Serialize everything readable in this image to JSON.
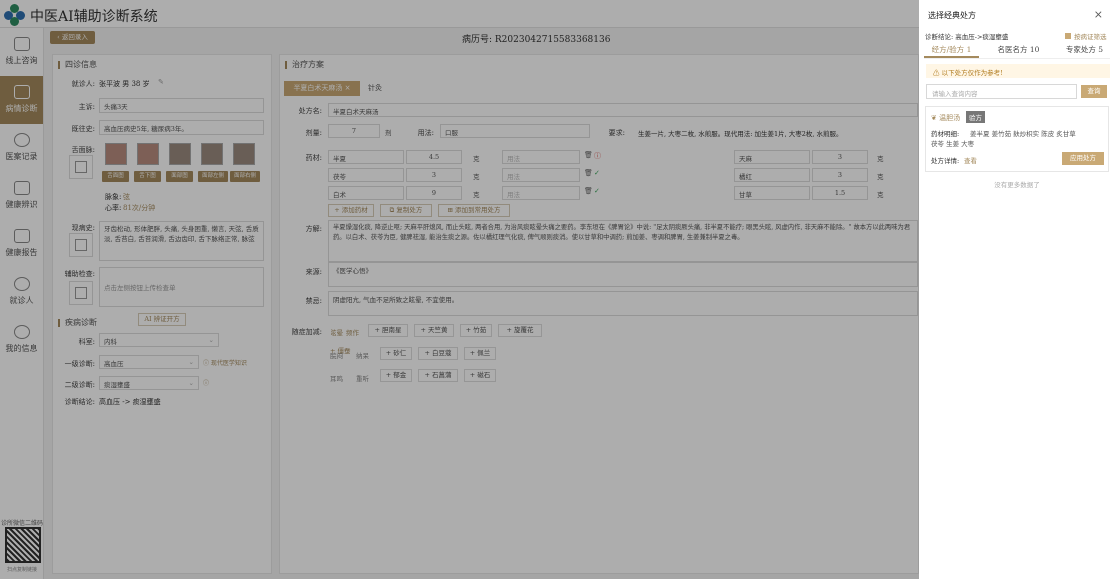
{
  "app": {
    "title": "中医AI辅助诊断系统"
  },
  "sidebar": {
    "items": [
      {
        "label": "线上咨询"
      },
      {
        "label": "病情诊断"
      },
      {
        "label": "医案记录"
      },
      {
        "label": "健康辨识"
      },
      {
        "label": "健康报告"
      },
      {
        "label": "就诊人"
      },
      {
        "label": "我的信息"
      }
    ],
    "qr_label": "诊所微信二维码",
    "qr_caption": "扫点复制链接"
  },
  "header": {
    "back": "返回录入",
    "record_no": "病历号: R2023042715583368136"
  },
  "four_diagnosis": {
    "title": "四诊信息",
    "patient_label": "就诊人:",
    "patient": "张平波  男  38 岁",
    "complaint_label": "主诉:",
    "complaint": "头痛3天",
    "history_label": "既往史:",
    "history": "高血压病史5年, 糖尿病3年。",
    "tongue_label": "舌面脉:",
    "tongue_buttons": [
      "舌面图",
      "舌下图",
      "面部图",
      "面部左侧",
      "面部右侧"
    ],
    "pulse_label": "脉象:",
    "pulse": "弦",
    "heart_label": "心率:",
    "heart": "81次/分钟",
    "current_label": "现病史:",
    "current": "牙齿松动, 形体肥胖, 头痛, 头身困重, 懒言, 天弦, 舌质淡, 舌苔白, 舌苔润滑, 舌边齿印, 舌下脉络正常, 脉弦",
    "aux_label": "辅助检查:",
    "aux": "点击左侧按钮上传检查单"
  },
  "diagnosis_result": {
    "title": "疾病诊断",
    "ai_button": "AI 辨证开方",
    "dept_label": "科室:",
    "dept": "内科",
    "first_label": "一级诊断:",
    "first": "高血压",
    "first_link": "现代医学知识",
    "second_label": "二级诊断:",
    "second": "痰湿壅盛",
    "conclusion_label": "诊断结论:",
    "conclusion": "高血压 -> 痰湿壅盛"
  },
  "treatment": {
    "title": "治疗方案",
    "tabs": [
      "半夏白术天麻汤",
      "针灸"
    ],
    "prescription_label": "处方名:",
    "prescription": "半夏白术天麻汤",
    "dose_label": "剂量:",
    "dose": "7",
    "dose_unit": "剂",
    "usage_label": "用法:",
    "usage": "口服",
    "require_label": "要求:",
    "require": "生姜一片, 大枣二枚, 水煎服。现代用法: 加生姜1片, 大枣2枚, 水煎服。",
    "herbs_label": "药材:",
    "herbs_left": [
      {
        "name": "半夏",
        "qty": "4.5",
        "unit": "克",
        "method": "用法"
      },
      {
        "name": "茯苓",
        "qty": "3",
        "unit": "克",
        "method": "用法"
      },
      {
        "name": "白术",
        "qty": "9",
        "unit": "克",
        "method": "用法"
      }
    ],
    "herbs_right": [
      {
        "name": "天麻",
        "qty": "3",
        "unit": "克"
      },
      {
        "name": "橘红",
        "qty": "3",
        "unit": "克"
      },
      {
        "name": "甘草",
        "qty": "1.5",
        "unit": "克"
      }
    ],
    "actions": [
      "+ 添加药材",
      "复制处方",
      "添加到常用处方"
    ],
    "formula_label": "方解:",
    "formula": "半夏燥湿化痰, 降逆止呕; 天麻平肝熄风, 而止头眩, 两者合用, 为治风痰眩晕头痛之要药。李东垣在《脾胃论》中说: \"足太阴痰厥头痛, 非半夏不能疗; 眼黑头眩, 风虚内作, 非天麻不能除。\" 故本方以此两味为君药。以白术、茯苓为臣, 健脾祛湿, 能治生痰之源。佐以橘红理气化痰, 俾气顺则痰消。使以甘草和中调药; 煎加姜、枣调和脾胃, 生姜兼制半夏之毒。",
    "source_label": "来源:",
    "source": "《医学心悟》",
    "taboo_label": "禁忌:",
    "taboo": "阴虚阳亢, 气血不足所致之眩晕, 不宜使用。",
    "adjust_label": "随症加减:",
    "adjust_rows": [
      {
        "tags": [
          "眩晕",
          "频作"
        ],
        "herbs": [
          "+ 僵蚕",
          "+ 胆南星",
          "+ 天竺黄",
          "+ 竹茹",
          "+ 旋覆花"
        ]
      },
      {
        "tags": [
          "脘闷",
          "纳呆"
        ],
        "herbs": [
          "+ 砂仁",
          "+ 白豆蔻",
          "+ 佩兰"
        ]
      },
      {
        "tags": [
          "耳鸣",
          "重听"
        ],
        "herbs": [
          "+ 郁金",
          "+ 石菖蒲",
          "+ 磁石"
        ]
      }
    ]
  },
  "drawer": {
    "title": "选择经典处方",
    "conclusion_label": "诊断结论:",
    "conclusion": "高血压->痰湿壅盛",
    "filter_label": "按病证筛选",
    "tabs": [
      "经方/验方 1",
      "名医名方 10",
      "专家处方 5"
    ],
    "notice": "以下处方仅作为参考!",
    "search_placeholder": "请输入查询内容",
    "search_button": "查询",
    "card": {
      "name": "温胆汤",
      "badge": "验方",
      "herbs_label": "药材明细:",
      "herbs_line1": "姜半夏  姜竹茹  麸炒枳实  陈皮  炙甘草",
      "herbs_line2": "茯苓  生姜  大枣",
      "detail_label": "处方详情:",
      "detail_link": "查看",
      "apply": "应用处方"
    },
    "no_more": "没有更多数据了"
  },
  "colors": {
    "accent": "#a48a5d",
    "accent_light": "#c9a975",
    "ok": "#3aa55a",
    "warn": "#d9534f"
  }
}
